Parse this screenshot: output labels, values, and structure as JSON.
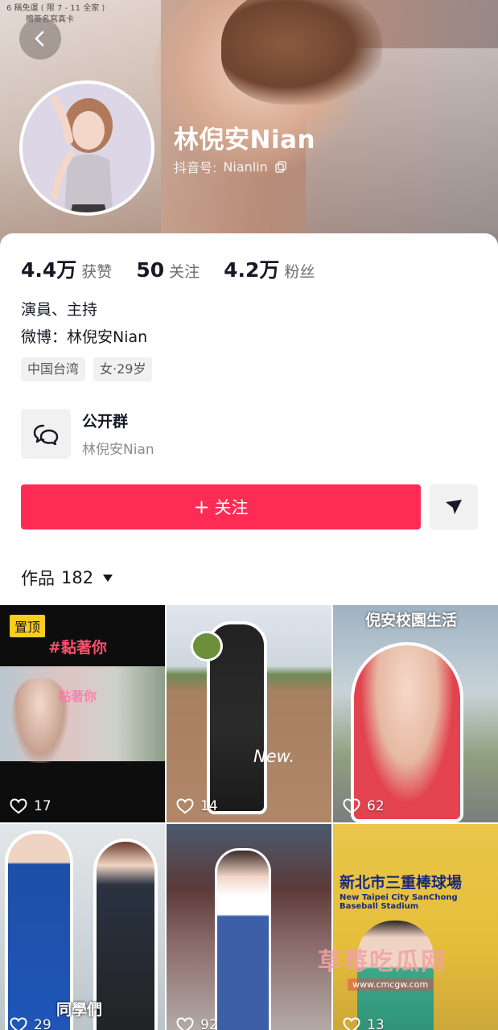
{
  "cover": {
    "banner_line1": "6 稱免運 ( 限 7 - 11 全家 )",
    "banner_line2": "贈簽名寫真卡"
  },
  "profile": {
    "name": "林倪安Nian",
    "account_label": "抖音号:",
    "account_id": "Nianlin"
  },
  "stats": [
    {
      "value": "4.4万",
      "label": "获赞"
    },
    {
      "value": "50",
      "label": "关注"
    },
    {
      "value": "4.2万",
      "label": "粉丝"
    }
  ],
  "bio": {
    "line1": "演員、主持",
    "line2": "微博：林倪安Nian",
    "tags": [
      "中国台湾",
      "女·29岁"
    ]
  },
  "group": {
    "title": "公开群",
    "subtitle": "林倪安Nian"
  },
  "actions": {
    "follow_label": "关注",
    "follow_plus": "+"
  },
  "works": {
    "label": "作品",
    "count": "182"
  },
  "posts": [
    {
      "likes": "17",
      "pin": "置顶",
      "title": "#黏著你",
      "sub": "黏著你"
    },
    {
      "likes": "14",
      "tag": "New."
    },
    {
      "likes": "62",
      "title": "倪安校園生活"
    },
    {
      "likes": "29",
      "caption": "同學們"
    },
    {
      "likes": "92"
    },
    {
      "likes": "13",
      "title": "新北市三重棒球場",
      "subtitle": "New Taipei City SanChong Baseball Stadium"
    }
  ],
  "watermark": {
    "text": "草莓吃瓜网",
    "url": "www.cmcgw.com"
  },
  "colors": {
    "accent": "#fe2c55",
    "pin": "#facd1e"
  }
}
